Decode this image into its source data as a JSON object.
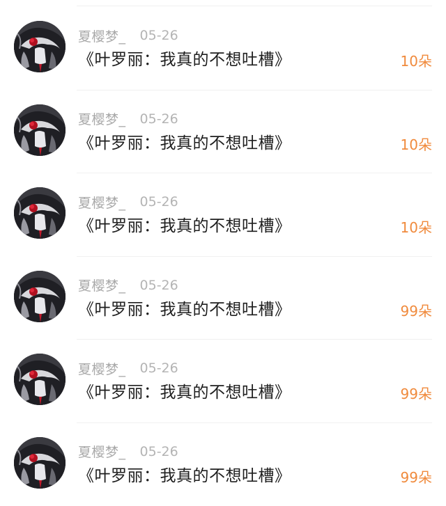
{
  "comments": [
    {
      "user": "夏樱梦_",
      "date": "05-26",
      "title": "《叶罗丽：我真的不想吐槽》",
      "gift": "10朵",
      "avatar_icon": "anime-girl-red-flower-avatar"
    },
    {
      "user": "夏樱梦_",
      "date": "05-26",
      "title": "《叶罗丽：我真的不想吐槽》",
      "gift": "10朵",
      "avatar_icon": "anime-girl-red-flower-avatar"
    },
    {
      "user": "夏樱梦_",
      "date": "05-26",
      "title": "《叶罗丽：我真的不想吐槽》",
      "gift": "10朵",
      "avatar_icon": "anime-girl-red-flower-avatar"
    },
    {
      "user": "夏樱梦_",
      "date": "05-26",
      "title": "《叶罗丽：我真的不想吐槽》",
      "gift": "99朵",
      "avatar_icon": "anime-girl-red-flower-avatar"
    },
    {
      "user": "夏樱梦_",
      "date": "05-26",
      "title": "《叶罗丽：我真的不想吐槽》",
      "gift": "99朵",
      "avatar_icon": "anime-girl-red-flower-avatar"
    },
    {
      "user": "夏樱梦_",
      "date": "05-26",
      "title": "《叶罗丽：我真的不想吐槽》",
      "gift": "99朵",
      "avatar_icon": "anime-girl-red-flower-avatar"
    }
  ],
  "colors": {
    "accent": "#f08a3c",
    "username": "#a9a9a9",
    "date": "#b4b4b4",
    "title": "#1e1e1e",
    "divider": "#f0f0f0"
  }
}
